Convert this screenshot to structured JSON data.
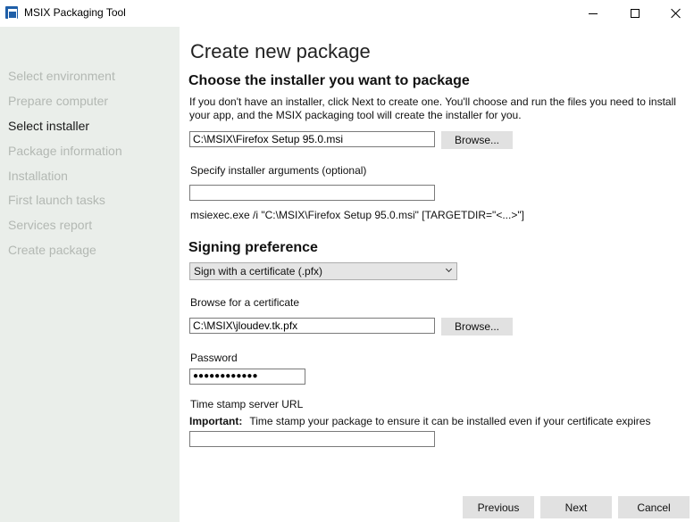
{
  "window": {
    "title": "MSIX Packaging Tool"
  },
  "sidebar": {
    "items": [
      {
        "label": "Select environment"
      },
      {
        "label": "Prepare computer"
      },
      {
        "label": "Select installer"
      },
      {
        "label": "Package information"
      },
      {
        "label": "Installation"
      },
      {
        "label": "First launch tasks"
      },
      {
        "label": "Services report"
      },
      {
        "label": "Create package"
      }
    ],
    "active_index": 2
  },
  "main": {
    "page_title": "Create new package",
    "installer_section": {
      "title": "Choose the installer you want to package",
      "description": "If you don't have an installer, click Next to create one. You'll choose and run the files you need to install your app, and the MSIX packaging tool will create the installer for you.",
      "installer_path": "C:\\MSIX\\Firefox Setup 95.0.msi",
      "browse_label": "Browse...",
      "args_label": "Specify installer arguments (optional)",
      "args_value": "",
      "command_preview": "msiexec.exe /i \"C:\\MSIX\\Firefox Setup 95.0.msi\"  [TARGETDIR=\"<...>\"]"
    },
    "signing_section": {
      "title": "Signing preference",
      "selected_option": "Sign with a certificate (.pfx)",
      "cert_label": "Browse for a certificate",
      "cert_path": "C:\\MSIX\\jloudev.tk.pfx",
      "browse_label": "Browse...",
      "password_label": "Password",
      "password_mask": "●●●●●●●●●●●●",
      "timestamp_label": "Time stamp server URL",
      "important_prefix": "Important:",
      "important_text": "Time stamp your package to ensure it can be installed even if your certificate expires",
      "timestamp_value": ""
    }
  },
  "footer": {
    "previous_label": "Previous",
    "next_label": "Next",
    "cancel_label": "Cancel"
  }
}
